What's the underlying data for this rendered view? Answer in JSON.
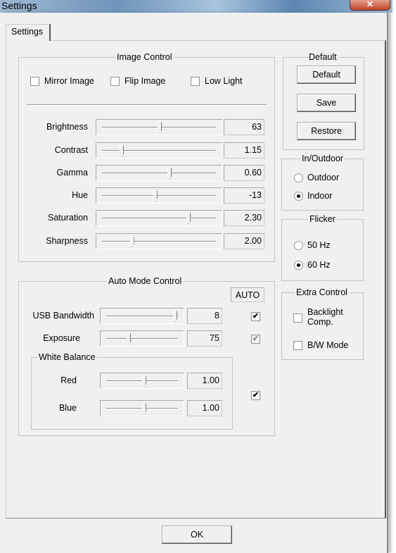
{
  "window": {
    "title": "Settings",
    "close_icon": "close-icon"
  },
  "tab": {
    "label": "Settings"
  },
  "image_control": {
    "title": "Image Control",
    "checkboxes": [
      {
        "label": "Mirror Image",
        "checked": false
      },
      {
        "label": "Flip Image",
        "checked": false
      },
      {
        "label": "Low Light",
        "checked": false
      }
    ],
    "sliders": [
      {
        "label": "Brightness",
        "value": "63",
        "position": 0.52
      },
      {
        "label": "Contrast",
        "value": "1.15",
        "position": 0.18
      },
      {
        "label": "Gamma",
        "value": "0.60",
        "position": 0.61
      },
      {
        "label": "Hue",
        "value": "-13",
        "position": 0.48
      },
      {
        "label": "Saturation",
        "value": "2.30",
        "position": 0.78
      },
      {
        "label": "Sharpness",
        "value": "2.00",
        "position": 0.27
      }
    ]
  },
  "auto_mode": {
    "title": "Auto Mode Control",
    "auto_label": "AUTO",
    "sliders": [
      {
        "label": "USB Bandwidth",
        "value": "8",
        "position": 1.0,
        "auto": true
      },
      {
        "label": "Exposure",
        "value": "75",
        "position": 0.33,
        "auto": true,
        "auto_disabled": true
      }
    ],
    "white_balance": {
      "title": "White Balance",
      "auto": true,
      "sliders": [
        {
          "label": "Red",
          "value": "1.00",
          "position": 0.55
        },
        {
          "label": "Blue",
          "value": "1.00",
          "position": 0.55
        }
      ]
    }
  },
  "default_group": {
    "title": "Default",
    "buttons": [
      "Default",
      "Save",
      "Restore"
    ]
  },
  "in_outdoor": {
    "title": "In/Outdoor",
    "options": [
      {
        "label": "Outdoor",
        "selected": false
      },
      {
        "label": "Indoor",
        "selected": true
      }
    ]
  },
  "flicker": {
    "title": "Flicker",
    "options": [
      {
        "label": "50 Hz",
        "selected": false
      },
      {
        "label": "60 Hz",
        "selected": true
      }
    ]
  },
  "extra_control": {
    "title": "Extra Control",
    "checkboxes": [
      {
        "label": "Backlight Comp.",
        "checked": false
      },
      {
        "label": "B/W Mode",
        "checked": false
      }
    ]
  },
  "footer": {
    "ok_label": "OK"
  }
}
